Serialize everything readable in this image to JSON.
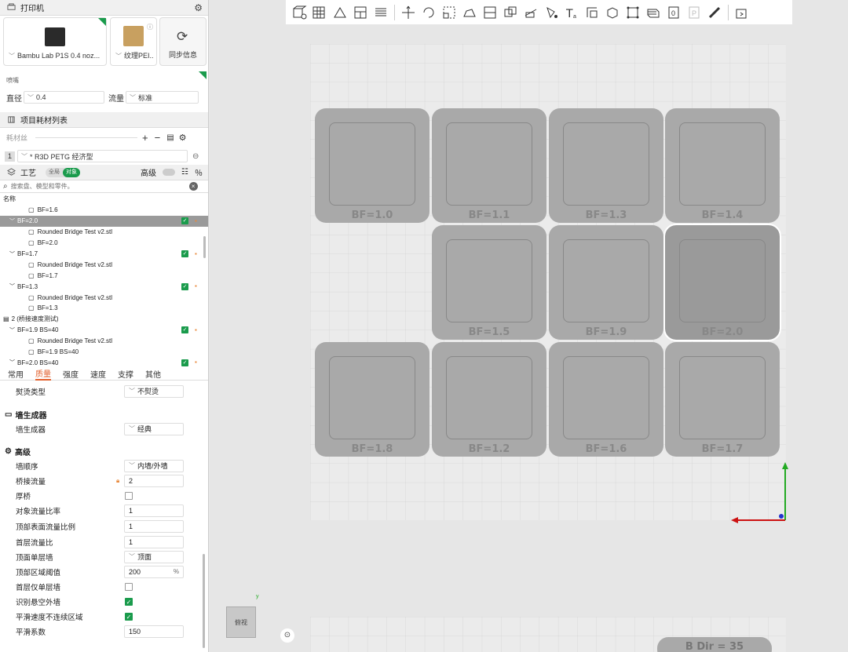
{
  "printer": {
    "title": "打印机",
    "machine_name": "Bambu Lab P1S 0.4 noz...",
    "plate_name": "纹理PEI...",
    "sync_label": "同步信息"
  },
  "nozzle": {
    "title": "喷嘴",
    "diameter_label": "直径",
    "diameter_value": "0.4",
    "flow_label": "流量",
    "flow_value": "标准"
  },
  "filament": {
    "section_title": "项目耗材列表",
    "header_label": "耗材丝",
    "slot_index": "1",
    "filament_name": "* R3D PETG 经济型"
  },
  "process": {
    "title": "工艺",
    "toggle_global": "全局",
    "toggle_object": "对象",
    "advanced_label": "高级",
    "search_placeholder": "搜索盘、模型和零件。",
    "list_header": "名称"
  },
  "object_list": [
    {
      "indent": 2,
      "label": "BF=1.6",
      "selected": false,
      "check": false
    },
    {
      "indent": 1,
      "label": "BF=2.0",
      "selected": true,
      "check": true
    },
    {
      "indent": 2,
      "label": "Rounded Bridge Test v2.stl",
      "selected": false,
      "check": false
    },
    {
      "indent": 2,
      "label": "BF=2.0",
      "selected": false,
      "check": false
    },
    {
      "indent": 1,
      "label": "BF=1.7",
      "selected": false,
      "check": true
    },
    {
      "indent": 2,
      "label": "Rounded Bridge Test v2.stl",
      "selected": false,
      "check": false
    },
    {
      "indent": 2,
      "label": "BF=1.7",
      "selected": false,
      "check": false
    },
    {
      "indent": 1,
      "label": "BF=1.3",
      "selected": false,
      "check": true
    },
    {
      "indent": 2,
      "label": "Rounded Bridge Test v2.stl",
      "selected": false,
      "check": false
    },
    {
      "indent": 2,
      "label": "BF=1.3",
      "selected": false,
      "check": false
    },
    {
      "indent": 0,
      "label": "2 (桥接速度测试)",
      "selected": false,
      "check": false
    },
    {
      "indent": 1,
      "label": "BF=1.9 BS=40",
      "selected": false,
      "check": true
    },
    {
      "indent": 2,
      "label": "Rounded Bridge Test v2.stl",
      "selected": false,
      "check": false
    },
    {
      "indent": 2,
      "label": "BF=1.9 BS=40",
      "selected": false,
      "check": false
    },
    {
      "indent": 1,
      "label": "BF=2.0 BS=40",
      "selected": false,
      "check": true
    }
  ],
  "tabs": [
    "常用",
    "质量",
    "强度",
    "速度",
    "支撑",
    "其他"
  ],
  "params": {
    "ironing_type_label": "熨烫类型",
    "ironing_type_value": "不熨烫",
    "wall_generator_group": "墙生成器",
    "wall_generator_label": "墙生成器",
    "wall_generator_value": "经典",
    "advanced_group": "高级",
    "wall_order_label": "墙顺序",
    "wall_order_value": "内墙/外墙",
    "bridge_flow_label": "桥接流量",
    "bridge_flow_value": "2",
    "thick_bridge_label": "厚桥",
    "object_flow_label": "对象流量比率",
    "object_flow_value": "1",
    "top_surface_flow_label": "顶部表面流量比例",
    "top_surface_flow_value": "1",
    "first_layer_flow_label": "首层流量比",
    "first_layer_flow_value": "1",
    "top_one_wall_label": "顶面单层墙",
    "top_one_wall_value": "顶面",
    "top_area_threshold_label": "顶部区域阈值",
    "top_area_threshold_value": "200",
    "top_area_threshold_unit": "%",
    "first_layer_one_wall_label": "首层仅单层墙",
    "detect_overhang_label": "识别悬空外墙",
    "smooth_speed_label": "平滑速度不连续区域",
    "smooth_coef_label": "平滑系数",
    "smooth_coef_value": "150"
  },
  "plate_tiles": [
    {
      "label": "BF=1.0",
      "selected": false
    },
    {
      "label": "BF=1.1",
      "selected": false
    },
    {
      "label": "BF=1.3",
      "selected": false
    },
    {
      "label": "BF=1.4",
      "selected": false
    },
    {
      "label": "BF=1.5",
      "selected": false
    },
    {
      "label": "BF=1.9",
      "selected": false
    },
    {
      "label": "BF=2.0",
      "selected": true
    },
    {
      "label": "BF=1.8",
      "selected": false
    },
    {
      "label": "BF=1.2",
      "selected": false
    },
    {
      "label": "BF=1.6",
      "selected": false
    },
    {
      "label": "BF=1.7",
      "selected": false
    }
  ],
  "viewport": {
    "view_cube_label": "俯视",
    "bottom_label": "B Dir = 35"
  },
  "colors": {
    "accent_green": "#1a9b4c",
    "accent_orange": "#e2612e",
    "axis_red": "#cc1111",
    "axis_green": "#22aa22",
    "axis_blue": "#2233cc"
  }
}
